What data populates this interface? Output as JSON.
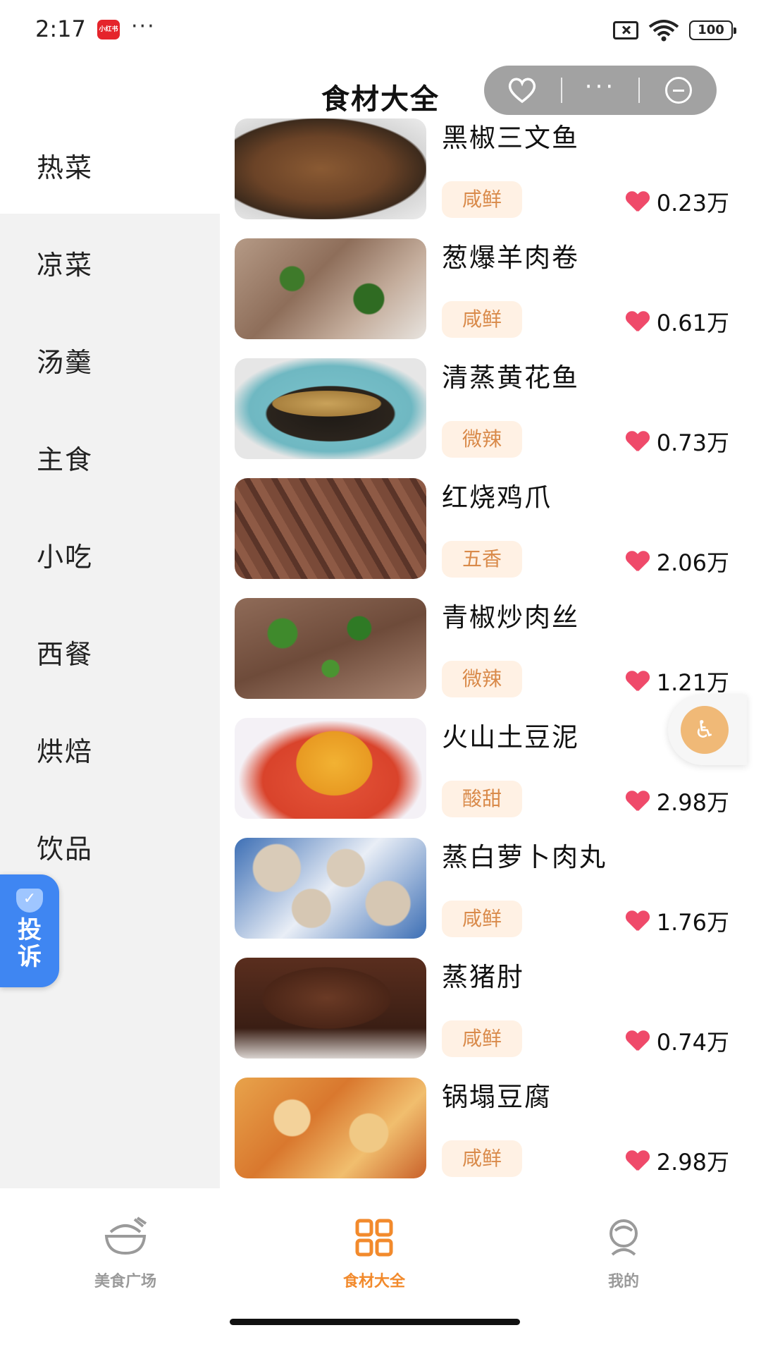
{
  "status_bar": {
    "time": "2:17",
    "app_badge": "小红书",
    "more": "···",
    "battery": "100"
  },
  "header": {
    "title": "食材大全"
  },
  "capsule": {
    "more": "···"
  },
  "sidebar": {
    "items": [
      {
        "label": "热菜",
        "active": true
      },
      {
        "label": "凉菜"
      },
      {
        "label": "汤羹"
      },
      {
        "label": "主食"
      },
      {
        "label": "小吃"
      },
      {
        "label": "西餐"
      },
      {
        "label": "烘焙"
      },
      {
        "label": "饮品"
      }
    ]
  },
  "complaint": {
    "line1": "投",
    "line2": "诉"
  },
  "dishes": [
    {
      "name": "黑椒三文鱼",
      "tag": "咸鲜",
      "likes": "0.23万"
    },
    {
      "name": "葱爆羊肉卷",
      "tag": "咸鲜",
      "likes": "0.61万"
    },
    {
      "name": "清蒸黄花鱼",
      "tag": "微辣",
      "likes": "0.73万"
    },
    {
      "name": "红烧鸡爪",
      "tag": "五香",
      "likes": "2.06万"
    },
    {
      "name": "青椒炒肉丝",
      "tag": "微辣",
      "likes": "1.21万"
    },
    {
      "name": "火山土豆泥",
      "tag": "酸甜",
      "likes": "2.98万"
    },
    {
      "name": "蒸白萝卜肉丸",
      "tag": "咸鲜",
      "likes": "1.76万"
    },
    {
      "name": "蒸猪肘",
      "tag": "咸鲜",
      "likes": "0.74万"
    },
    {
      "name": "锅塌豆腐",
      "tag": "咸鲜",
      "likes": "2.98万"
    }
  ],
  "bottom_nav": [
    {
      "label": "美食广场",
      "icon": "bowl-icon"
    },
    {
      "label": "食材大全",
      "icon": "grid-icon",
      "active": true
    },
    {
      "label": "我的",
      "icon": "profile-icon"
    }
  ],
  "colors": {
    "accent": "#f28a2c",
    "tag_bg": "#fff1e4",
    "tag_text": "#d98a4a",
    "heart": "#ef4a6a",
    "complaint": "#3f86f2"
  }
}
